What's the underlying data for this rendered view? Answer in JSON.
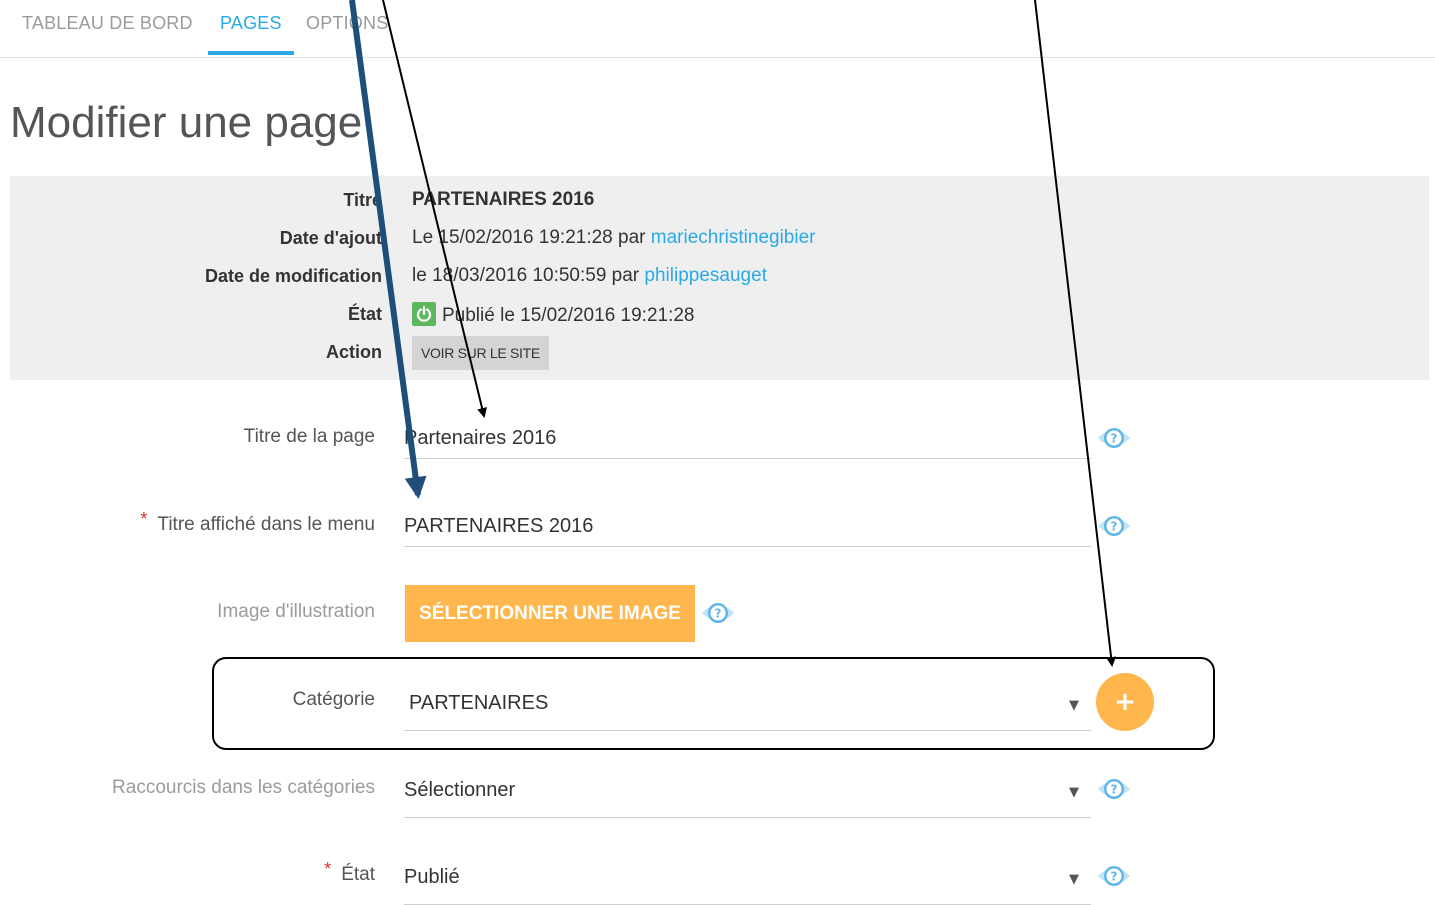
{
  "tabs": [
    {
      "label": "TABLEAU DE BORD",
      "active": false
    },
    {
      "label": "PAGES",
      "active": true
    },
    {
      "label": "OPTIONS",
      "active": false
    }
  ],
  "page_title": "Modifier une page",
  "info": {
    "title_label": "Titre",
    "title_value": "PARTENAIRES 2016",
    "added_label": "Date d'ajout",
    "added_text": "Le 15/02/2016 19:21:28 par ",
    "added_user": "mariechristinegibier",
    "modified_label": "Date de modification",
    "modified_text": "le 18/03/2016 10:50:59 par ",
    "modified_user": "philippesauget",
    "state_label": "État",
    "state_text": "Publié le 15/02/2016 19:21:28",
    "action_label": "Action",
    "action_button": "VOIR SUR LE SITE"
  },
  "form": {
    "page_title_label": "Titre de la page",
    "page_title_value": "Partenaires 2016",
    "menu_title_label": "Titre affiché dans le menu",
    "menu_title_value": "PARTENAIRES 2016",
    "image_label": "Image d'illustration",
    "image_button": "SÉLECTIONNER UNE IMAGE",
    "category_label": "Catégorie",
    "category_value": "PARTENAIRES",
    "shortcuts_label": "Raccourcis dans les catégories",
    "shortcuts_value": "Sélectionner",
    "state_label": "État",
    "state_value": "Publié",
    "required_mark": "*",
    "add_symbol": "+"
  },
  "icons": {
    "help": "help-icon",
    "power": "power-icon",
    "caret": "caret-down-icon"
  },
  "colors": {
    "accent": "#29a9e6",
    "orange": "#ffb74d",
    "success": "#5cb85c",
    "required": "#d9302c"
  }
}
